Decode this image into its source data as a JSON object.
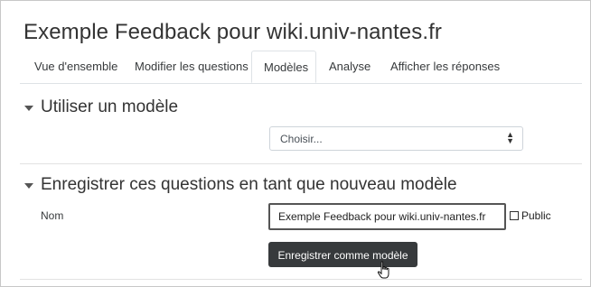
{
  "page": {
    "title": "Exemple Feedback pour wiki.univ-nantes.fr"
  },
  "tabs": [
    {
      "label": "Vue d'ensemble",
      "active": false
    },
    {
      "label": "Modifier les questions",
      "active": false
    },
    {
      "label": "Modèles",
      "active": true
    },
    {
      "label": "Analyse",
      "active": false
    },
    {
      "label": "Afficher les réponses",
      "active": false
    }
  ],
  "use_template": {
    "heading": "Utiliser un modèle",
    "select_value": "Choisir..."
  },
  "save_template": {
    "heading": "Enregistrer ces questions en tant que nouveau modèle",
    "name_label": "Nom",
    "name_value": "Exemple Feedback pour wiki.univ-nantes.fr",
    "public_label": "Public",
    "public_checked": false,
    "save_button": "Enregistrer comme modèle"
  },
  "colors": {
    "button_bg": "#373a3c",
    "tab_border": "#dee2e6"
  },
  "icons": [
    "caret-down-icon",
    "select-arrows-icon",
    "hand-pointer-cursor-icon"
  ]
}
